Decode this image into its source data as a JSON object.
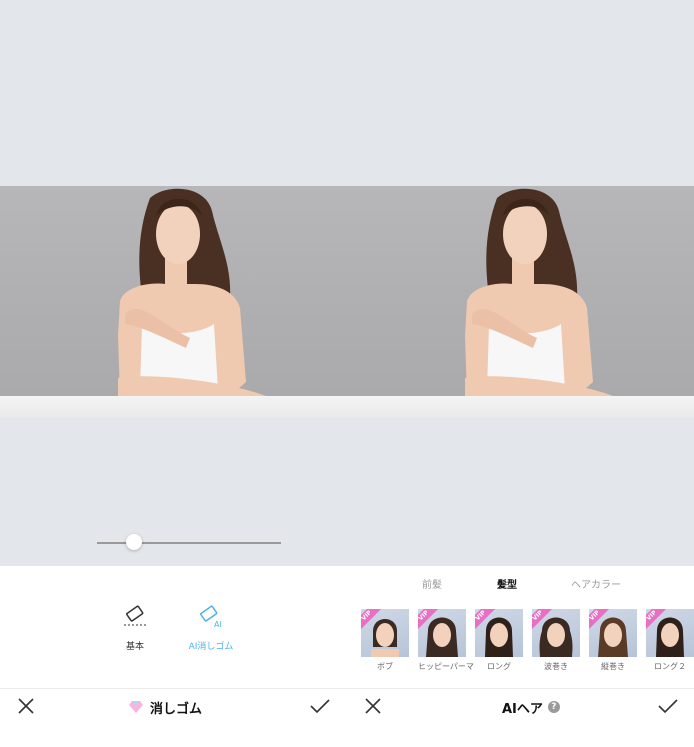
{
  "left": {
    "title": "消しゴム",
    "slider": {
      "value": 0.2
    },
    "tools": [
      {
        "label": "基本",
        "icon": "eraser-icon",
        "color": "#333333"
      },
      {
        "label": "AI消しゴム",
        "icon": "ai-eraser-icon",
        "color": "#4fb3e8"
      }
    ]
  },
  "right": {
    "title": "AIヘア",
    "help": "?",
    "tabs": [
      {
        "label": "前髪",
        "active": false
      },
      {
        "label": "髪型",
        "active": true
      },
      {
        "label": "ヘアカラー",
        "active": false
      }
    ],
    "styles": [
      {
        "label": "ボブ",
        "badge": "VIP"
      },
      {
        "label": "ヒッピーパーマ",
        "badge": "VIP"
      },
      {
        "label": "ロング",
        "badge": "VIP"
      },
      {
        "label": "波巻き",
        "badge": "VIP"
      },
      {
        "label": "縦巻き",
        "badge": "VIP"
      },
      {
        "label": "ロング２",
        "badge": "VIP"
      }
    ]
  },
  "colors": {
    "accent": "#4fb3e8",
    "vip": "#e96fc5",
    "background": "#e3e6ea"
  }
}
